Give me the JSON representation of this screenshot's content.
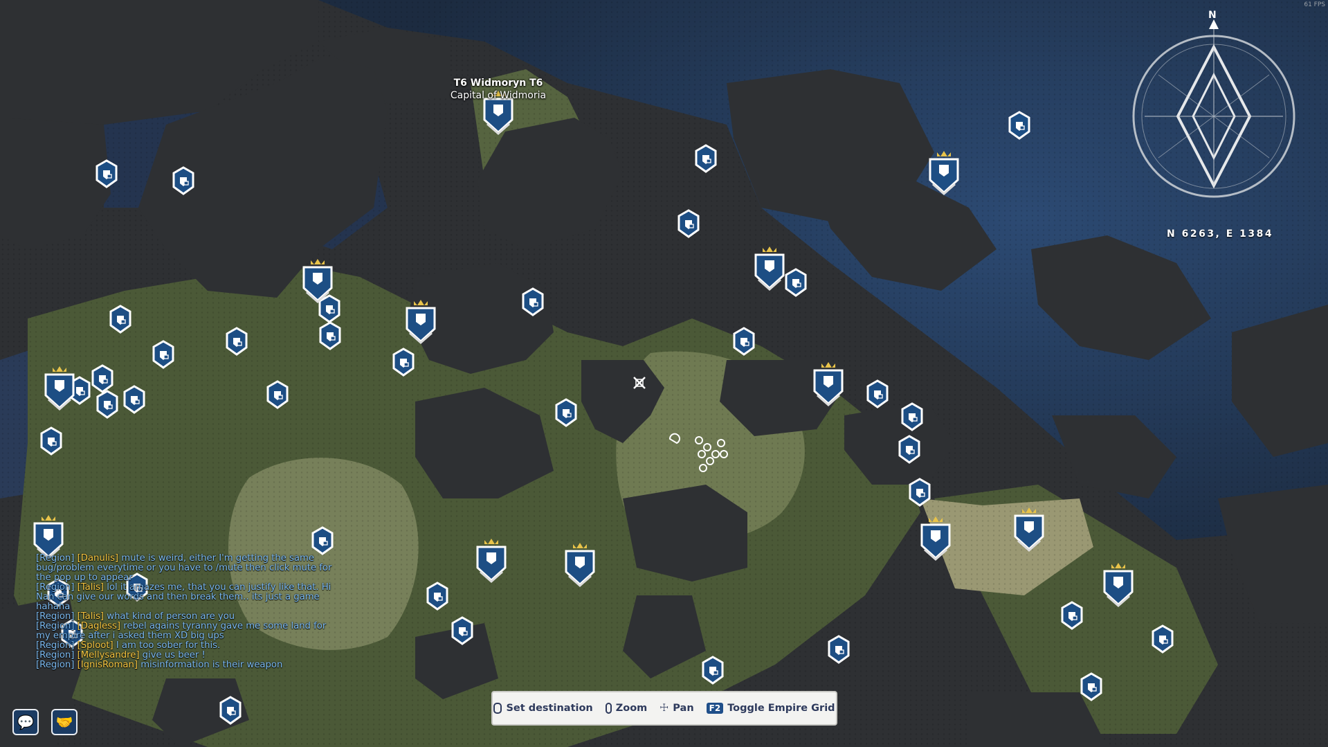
{
  "hud": {
    "fps": "61 FPS",
    "coordinates": "N 6263, E 1384",
    "compass_north": "N"
  },
  "capital": {
    "title": "T6 Widmoryn T6",
    "subtitle": "Capital of Widmoria"
  },
  "chat": [
    {
      "channel": "[Region]",
      "who": "[Danulis]",
      "text": " mute is weird, either I'm getting the same bug/problem everytime or you have to /mute then click mute for the pop up to appear"
    },
    {
      "channel": "[Region]",
      "who": "[Talis]",
      "text": " lol it amazes me,  that you can justify like that. Hi  Nan can give our words and then break them.. its just a game hahaha"
    },
    {
      "channel": "[Region]",
      "who": "[Talis]",
      "text": " what kind of person are you"
    },
    {
      "channel": "[Region]",
      "who": "[Dagless]",
      "text": " rebel agains tyranny gave me some land for my empire after i asked them XD big ups"
    },
    {
      "channel": "[Region]",
      "who": "[Sploot]",
      "text": " I am too sober for this."
    },
    {
      "channel": "[Region]",
      "who": "[Mellysandre]",
      "text": " give us beer !"
    },
    {
      "channel": "[Region]",
      "who": "[IgnisRoman]",
      "text": " misinformation is their weapon"
    }
  ],
  "controls": {
    "set_destination": "Set destination",
    "zoom": "Zoom",
    "pan": "Pan",
    "empire_key": "F2",
    "toggle_grid": "Toggle Empire Grid"
  },
  "buttons": {
    "chat_icon": "chat-icon",
    "handshake_icon": "handshake-icon"
  },
  "colors": {
    "water_deep": "#1c2a3d",
    "water": "#2b4468",
    "land_dark": "#333935",
    "grass": "#4f5e3a",
    "grass_light": "#6e7750",
    "sand": "#a3a377",
    "marker_blue": "#1d4e84"
  }
}
